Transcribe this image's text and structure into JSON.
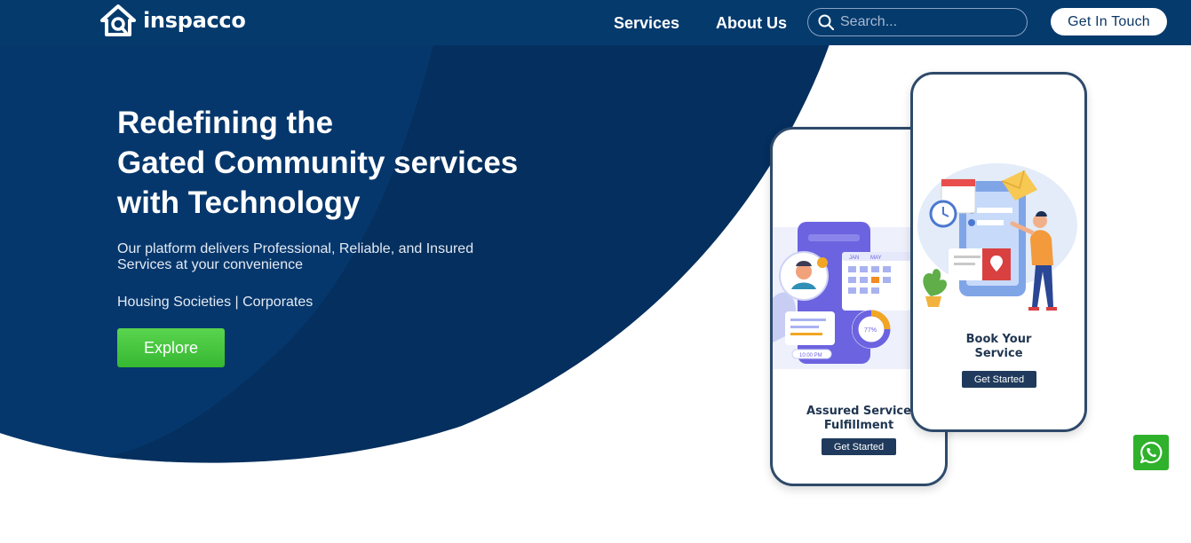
{
  "brand": {
    "name": "inspacco",
    "colors": {
      "navy": "#053a6d",
      "navy_dark": "#032a52",
      "accent_green": "#3cbf37",
      "whatsapp_green": "#2fb12c"
    }
  },
  "nav": {
    "links": [
      "Services",
      "About Us"
    ],
    "search_placeholder": "Search...",
    "cta_label": "Get In Touch"
  },
  "hero": {
    "title_lines": [
      "Redefining the",
      "Gated Community services",
      "with Technology"
    ],
    "subtitle_lines": [
      "Our platform delivers Professional, Reliable, and Insured",
      "Services at your convenience"
    ],
    "segments": "Housing Societies | Corporates",
    "explore_label": "Explore"
  },
  "phones": [
    {
      "caption_lines": [
        "Assured Service",
        "Fulfillment"
      ],
      "button_label": "Get Started"
    },
    {
      "caption_lines": [
        "Book Your",
        "Service"
      ],
      "button_label": "Get Started"
    }
  ],
  "illustration_text": {
    "calendar_tabs": [
      "JAN",
      "MAY"
    ],
    "badge": "77%",
    "time": "10:00 PM"
  },
  "icons": {
    "logo": "home-logo-icon",
    "search": "search-icon",
    "whatsapp": "whatsapp-icon"
  }
}
